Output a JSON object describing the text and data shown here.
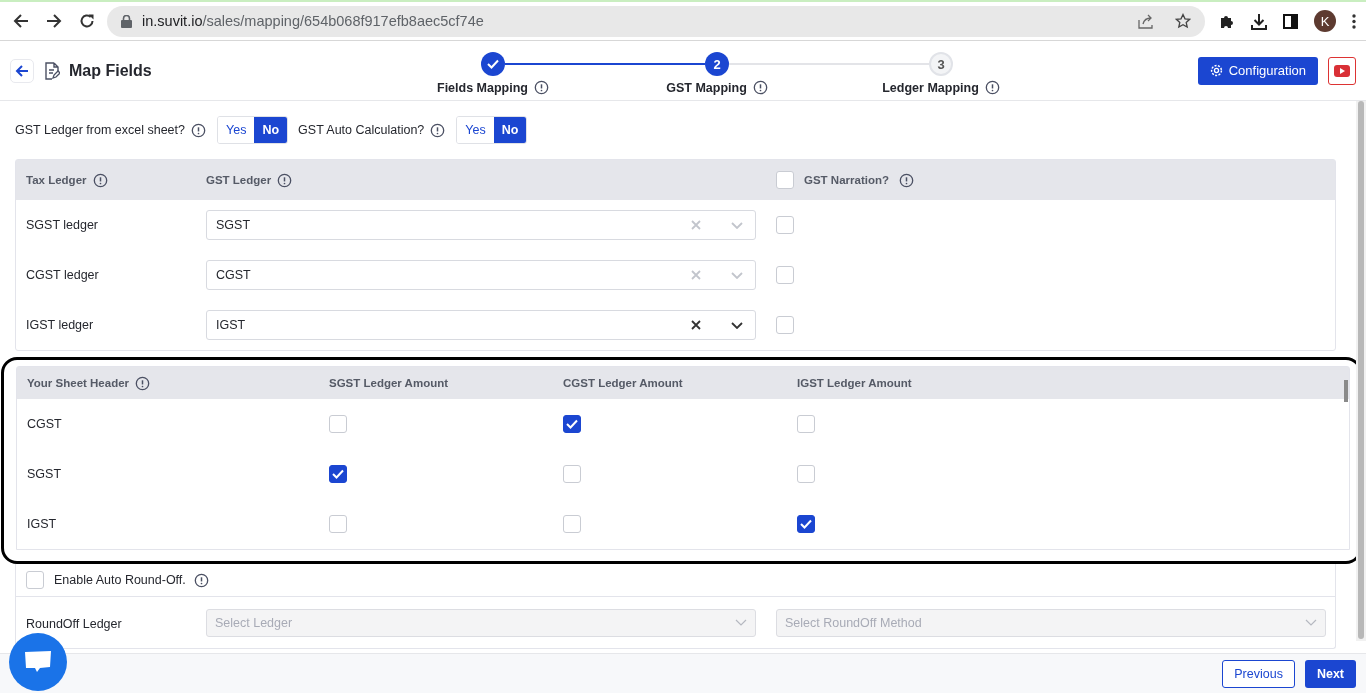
{
  "browser": {
    "url_host": "in.suvit.io",
    "url_path": "/sales/mapping/654b068f917efb8aec5cf74e",
    "avatar": "K"
  },
  "header": {
    "title": "Map Fields",
    "config_button": "Configuration",
    "steps": [
      {
        "label": "Fields Mapping",
        "kind": "completed"
      },
      {
        "number": "2",
        "label": "GST Mapping",
        "kind": "current"
      },
      {
        "number": "3",
        "label": "Ledger Mapping",
        "kind": "upcoming"
      }
    ]
  },
  "toggles": [
    {
      "label": "GST Ledger from excel sheet?",
      "options": [
        {
          "label": "Yes",
          "selected": false
        },
        {
          "label": "No",
          "selected": true
        }
      ]
    },
    {
      "label": "GST Auto Calculation?",
      "options": [
        {
          "label": "Yes",
          "selected": false
        },
        {
          "label": "No",
          "selected": true
        }
      ]
    }
  ],
  "ledger_table": {
    "columns": [
      "Tax Ledger",
      "GST Ledger"
    ],
    "narration": {
      "label": "GST Narration?",
      "checked": false
    },
    "rows": [
      {
        "name": "SGST ledger",
        "value": "SGST",
        "disabled": true,
        "narration_checked": false
      },
      {
        "name": "CGST ledger",
        "value": "CGST",
        "disabled": true,
        "narration_checked": false
      },
      {
        "name": "IGST ledger",
        "value": "IGST",
        "disabled": false,
        "narration_checked": false
      }
    ]
  },
  "mapping_table": {
    "columns": [
      "Your Sheet Header",
      "SGST Ledger Amount",
      "CGST Ledger Amount",
      "IGST Ledger Amount"
    ],
    "rows": [
      {
        "header": "CGST",
        "cells": [
          {
            "checked": false
          },
          {
            "checked": true
          },
          {
            "checked": false
          }
        ]
      },
      {
        "header": "SGST",
        "cells": [
          {
            "checked": true
          },
          {
            "checked": false
          },
          {
            "checked": false
          }
        ]
      },
      {
        "header": "IGST",
        "cells": [
          {
            "checked": false
          },
          {
            "checked": false
          },
          {
            "checked": true
          }
        ]
      }
    ]
  },
  "round_off": {
    "label": "Enable Auto Round-Off.",
    "checked": false
  },
  "roundoff_ledger": {
    "label": "RoundOff Ledger",
    "ledger_placeholder": "Select Ledger",
    "method_placeholder": "Select RoundOff Method"
  },
  "footer": {
    "previous": "Previous",
    "next": "Next"
  }
}
